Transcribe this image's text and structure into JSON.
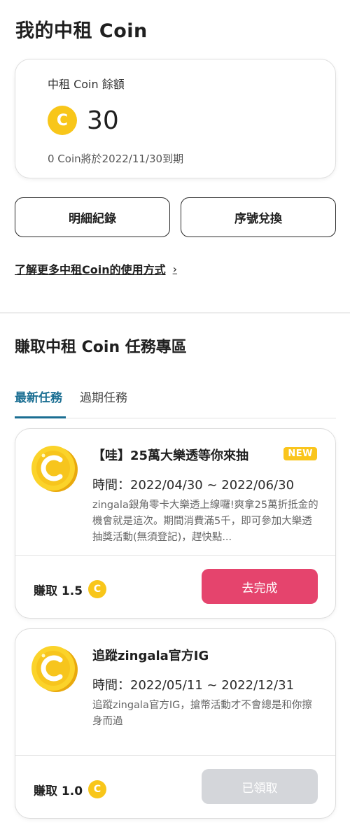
{
  "header": {
    "title": "我的中租 Coin"
  },
  "balance": {
    "label": "中租 Coin 餘額",
    "coin_letter": "C",
    "amount": "30",
    "expiry_note": "0 Coin將於2022/11/30到期"
  },
  "buttons": {
    "detail": "明細紀錄",
    "redeem": "序號兌換"
  },
  "learn_more": {
    "text": "了解更多中租Coin的使用方式",
    "chevron": "›"
  },
  "tasks_section": {
    "title": "賺取中租 Coin 任務專區",
    "tabs": [
      {
        "label": "最新任務",
        "active": true
      },
      {
        "label": "過期任務",
        "active": false
      }
    ]
  },
  "tasks": [
    {
      "title": "【哇】25萬大樂透等你來抽",
      "badge": "NEW",
      "time": "時間：2022/04/30 ~ 2022/06/30",
      "description": "zingala銀角零卡大樂透上線囉!爽拿25萬折抵金的機會就是這次。期間消費滿5千，即可參加大樂透抽獎活動(無須登記)，趕快點...",
      "reward_label": "賺取 1.5",
      "reward_coin": "C",
      "action_label": "去完成",
      "action_state": "active"
    },
    {
      "title": "追蹤zingala官方IG",
      "time": "時間：2022/05/11 ~ 2022/12/31",
      "description": "追蹤zingala官方IG，搶幣活動才不會總是和你擦身而過",
      "reward_label": "賺取 1.0",
      "reward_coin": "C",
      "action_label": "已領取",
      "action_state": "disabled"
    }
  ],
  "colors": {
    "accent_tab": "#1a6e92",
    "coin": "#f8c61a",
    "primary_button": "#e5446d",
    "disabled_button": "#d4d6da"
  }
}
